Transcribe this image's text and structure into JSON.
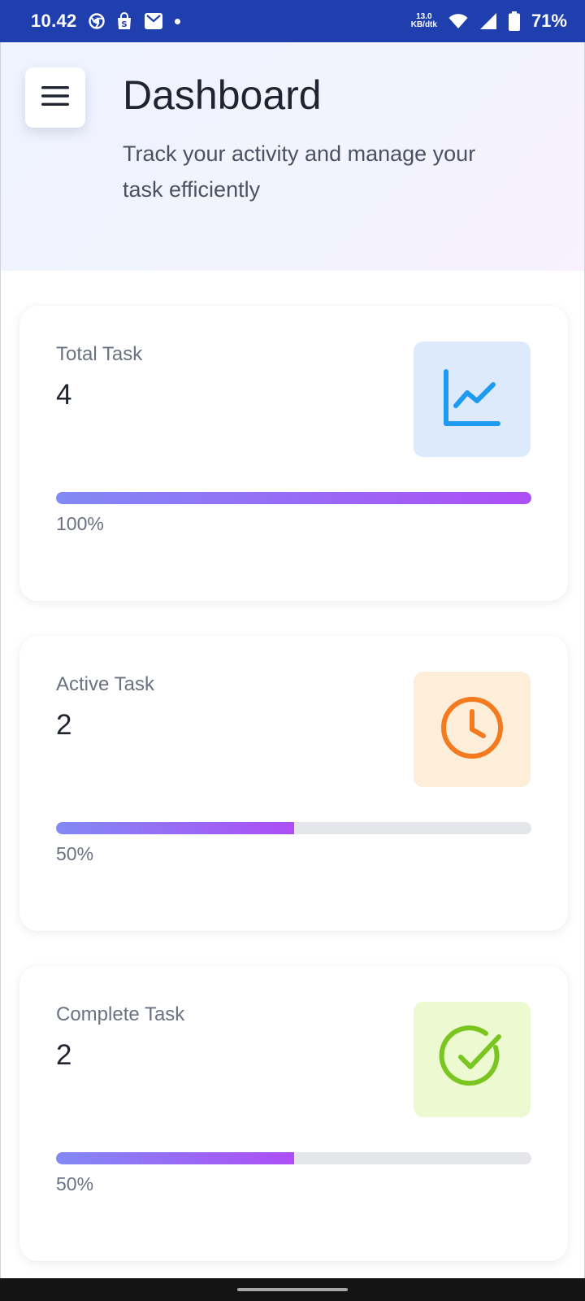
{
  "status_bar": {
    "time": "10.42",
    "net_speed_value": "13.0",
    "net_speed_unit": "KB/dtk",
    "battery": "71%",
    "icons": [
      "chrome-icon",
      "shop-icon",
      "mail-icon",
      "dot-icon",
      "wifi-icon",
      "signal-icon",
      "battery-icon"
    ]
  },
  "header": {
    "title": "Dashboard",
    "subtitle": "Track your activity and manage your task efficiently",
    "menu_icon": "hamburger-menu-icon"
  },
  "cards": [
    {
      "label": "Total Task",
      "value": "4",
      "progress": 100,
      "progress_label": "100%",
      "icon": "chart-line-icon",
      "icon_color": "#1e9af0",
      "icon_bg": "#dceafc"
    },
    {
      "label": "Active Task",
      "value": "2",
      "progress": 50,
      "progress_label": "50%",
      "icon": "clock-icon",
      "icon_color": "#f47a1f",
      "icon_bg": "#fdeed9"
    },
    {
      "label": "Complete Task",
      "value": "2",
      "progress": 50,
      "progress_label": "50%",
      "icon": "check-circle-icon",
      "icon_color": "#7ac520",
      "icon_bg": "#ecf9d1"
    }
  ],
  "colors": {
    "status_bar": "#1f3fae",
    "progress_start": "#8289f5",
    "progress_end": "#ad4ef5",
    "track": "#e5e6e9"
  }
}
